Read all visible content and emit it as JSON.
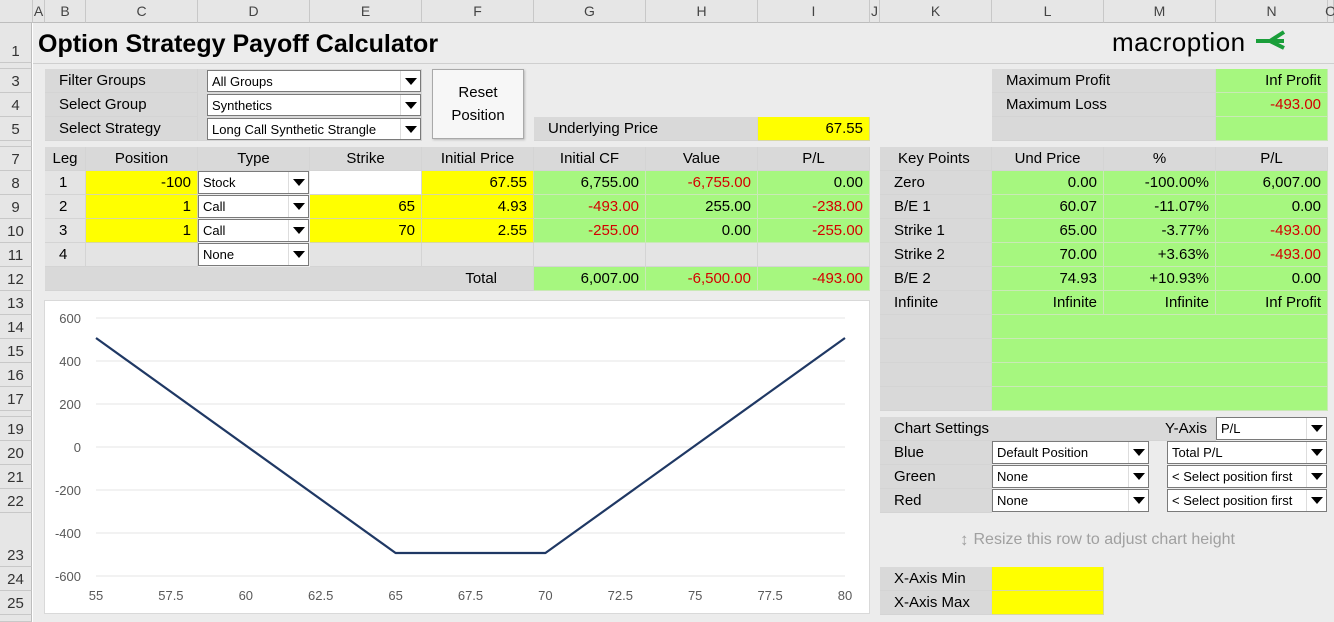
{
  "columns": [
    "A",
    "B",
    "C",
    "D",
    "E",
    "F",
    "G",
    "H",
    "I",
    "J",
    "K",
    "L",
    "M",
    "N",
    "O"
  ],
  "rows": [
    "1",
    "3",
    "4",
    "5",
    "7",
    "8",
    "9",
    "10",
    "11",
    "12",
    "13",
    "14",
    "15",
    "16",
    "17",
    "19",
    "20",
    "21",
    "22",
    "23",
    "24",
    "25"
  ],
  "title": "Option Strategy Payoff Calculator",
  "logo": {
    "text": "macroption",
    "accent": "#1a9e3a"
  },
  "selectors": {
    "filter_groups_label": "Filter Groups",
    "filter_groups_value": "All Groups",
    "select_group_label": "Select Group",
    "select_group_value": "Synthetics",
    "select_strategy_label": "Select Strategy",
    "select_strategy_value": "Long Call Synthetic Strangle"
  },
  "reset_button": "Reset Position",
  "underlying": {
    "label": "Underlying Price",
    "value": "67.55"
  },
  "summary": {
    "max_profit_label": "Maximum Profit",
    "max_profit_value": "Inf Profit",
    "max_loss_label": "Maximum Loss",
    "max_loss_value": "-493.00"
  },
  "legs_table": {
    "headers": [
      "Leg",
      "Position",
      "Type",
      "Strike",
      "Initial Price",
      "Initial CF",
      "Value",
      "P/L"
    ],
    "rows": [
      {
        "leg": "1",
        "position": "-100",
        "type": "Stock",
        "strike": "",
        "initial_price": "67.55",
        "initial_cf": "6,755.00",
        "value": "-6,755.00",
        "pl": "0.00"
      },
      {
        "leg": "2",
        "position": "1",
        "type": "Call",
        "strike": "65",
        "initial_price": "4.93",
        "initial_cf": "-493.00",
        "value": "255.00",
        "pl": "-238.00"
      },
      {
        "leg": "3",
        "position": "1",
        "type": "Call",
        "strike": "70",
        "initial_price": "2.55",
        "initial_cf": "-255.00",
        "value": "0.00",
        "pl": "-255.00"
      },
      {
        "leg": "4",
        "position": "",
        "type": "None",
        "strike": "",
        "initial_price": "",
        "initial_cf": "",
        "value": "",
        "pl": ""
      }
    ],
    "total_label": "Total",
    "total_cf": "6,007.00",
    "total_value": "-6,500.00",
    "total_pl": "-493.00"
  },
  "key_points": {
    "headers": [
      "Key Points",
      "Und Price",
      "%",
      "P/L"
    ],
    "rows": [
      {
        "name": "Zero",
        "price": "0.00",
        "pct": "-100.00%",
        "pl": "6,007.00"
      },
      {
        "name": "B/E 1",
        "price": "60.07",
        "pct": "-11.07%",
        "pl": "0.00"
      },
      {
        "name": "Strike 1",
        "price": "65.00",
        "pct": "-3.77%",
        "pl": "-493.00"
      },
      {
        "name": "Strike 2",
        "price": "70.00",
        "pct": "+3.63%",
        "pl": "-493.00"
      },
      {
        "name": "B/E 2",
        "price": "74.93",
        "pct": "+10.93%",
        "pl": "0.00"
      },
      {
        "name": "Infinite",
        "price": "Infinite",
        "pct": "Infinite",
        "pl": "Inf Profit"
      }
    ]
  },
  "chart_settings": {
    "label": "Chart Settings",
    "yaxis_label": "Y-Axis",
    "yaxis_value": "P/L",
    "rows": [
      {
        "label": "Blue",
        "position": "Default Position",
        "series": "Total P/L"
      },
      {
        "label": "Green",
        "position": "None",
        "series": "< Select position first"
      },
      {
        "label": "Red",
        "position": "None",
        "series": "< Select position first"
      }
    ],
    "resize_hint": "Resize this row to adjust chart height"
  },
  "xaxis": {
    "min_label": "X-Axis Min",
    "max_label": "X-Axis Max",
    "min_value": "",
    "max_value": ""
  },
  "chart_data": {
    "type": "line",
    "series": [
      {
        "x": [
          55,
          65,
          70,
          80
        ],
        "y": [
          507,
          -493,
          -493,
          507
        ],
        "color": "#1f3864"
      }
    ],
    "xlim": [
      55,
      80
    ],
    "ylim": [
      -600,
      600
    ],
    "x_ticks": [
      "55",
      "57.5",
      "60",
      "62.5",
      "65",
      "67.5",
      "70",
      "72.5",
      "75",
      "77.5",
      "80"
    ],
    "y_ticks": [
      "600",
      "400",
      "200",
      "0",
      "-200",
      "-400",
      "-600"
    ],
    "grid": "horizontal"
  }
}
